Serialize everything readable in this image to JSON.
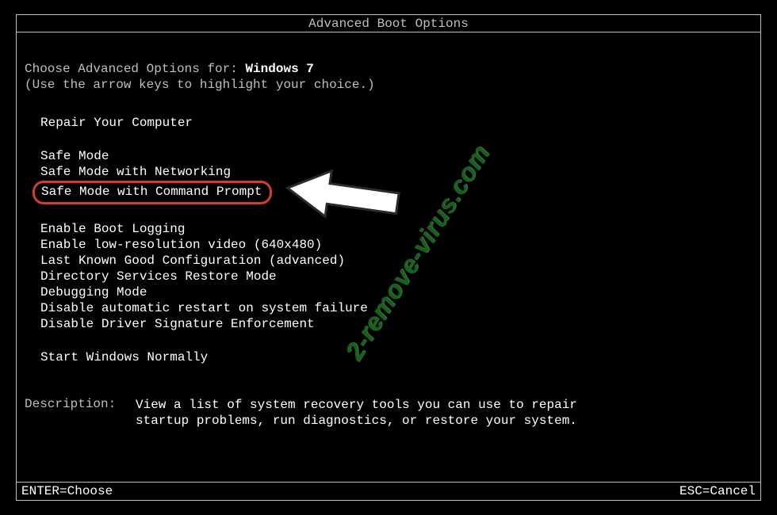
{
  "title": "Advanced Boot Options",
  "subtitle_prefix": "Choose Advanced Options for: ",
  "os_name": "Windows 7",
  "subtitle_hint": "(Use the arrow keys to highlight your choice.)",
  "groups": [
    {
      "items": [
        "Repair Your Computer"
      ]
    },
    {
      "items": [
        "Safe Mode",
        "Safe Mode with Networking",
        "Safe Mode with Command Prompt"
      ]
    },
    {
      "items": [
        "Enable Boot Logging",
        "Enable low-resolution video (640x480)",
        "Last Known Good Configuration (advanced)",
        "Directory Services Restore Mode",
        "Debugging Mode",
        "Disable automatic restart on system failure",
        "Disable Driver Signature Enforcement"
      ]
    },
    {
      "items": [
        "Start Windows Normally"
      ]
    }
  ],
  "highlighted_item": "Safe Mode with Command Prompt",
  "selected_item": "Repair Your Computer",
  "description_label": "Description:",
  "description_line1": "View a list of system recovery tools you can use to repair",
  "description_line2": "startup problems, run diagnostics, or restore your system.",
  "footer_left": "ENTER=Choose",
  "footer_right": "ESC=Cancel",
  "watermark": "2-remove-virus.com",
  "colors": {
    "dim": "#bfbfbf",
    "bright": "#ffffff",
    "capsule": "#d63b2f",
    "watermark": "#1a5d1f"
  }
}
